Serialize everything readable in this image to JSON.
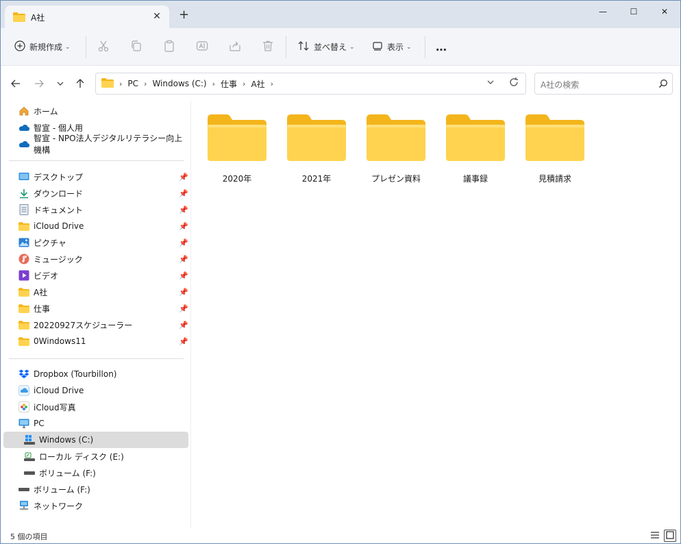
{
  "window": {
    "tab_title": "A社",
    "minimize_glyph": "—",
    "maximize_glyph": "☐",
    "close_glyph": "✕"
  },
  "toolbar": {
    "new_label": "新規作成",
    "sort_label": "並べ替え",
    "view_label": "表示",
    "more_label": "…"
  },
  "address": {
    "crumbs": [
      "PC",
      "Windows (C:)",
      "仕事",
      "A社"
    ],
    "search_placeholder": "A社の検索"
  },
  "sidebar": {
    "quick": [
      {
        "label": "ホーム",
        "icon": "home-icon"
      },
      {
        "label": "智宣 - 個人用",
        "icon": "onedrive-icon"
      },
      {
        "label": "智宣 - NPO法人デジタルリテラシー向上機構",
        "icon": "onedrive-icon"
      }
    ],
    "pinned": [
      {
        "label": "デスクトップ",
        "icon": "desktop-icon"
      },
      {
        "label": "ダウンロード",
        "icon": "download-icon"
      },
      {
        "label": "ドキュメント",
        "icon": "document-icon"
      },
      {
        "label": "iCloud Drive",
        "icon": "folder-icon"
      },
      {
        "label": "ピクチャ",
        "icon": "pictures-icon"
      },
      {
        "label": "ミュージック",
        "icon": "music-icon"
      },
      {
        "label": "ビデオ",
        "icon": "video-icon"
      },
      {
        "label": "A社",
        "icon": "folder-icon"
      },
      {
        "label": "仕事",
        "icon": "folder-icon"
      },
      {
        "label": "20220927スケジューラー",
        "icon": "folder-icon"
      },
      {
        "label": "0Windows11",
        "icon": "folder-icon"
      }
    ],
    "devices": [
      {
        "label": "Dropbox (Tourbillon)",
        "icon": "dropbox-icon"
      },
      {
        "label": "iCloud Drive",
        "icon": "icloud-icon"
      },
      {
        "label": "iCloud写真",
        "icon": "icloud-photos-icon"
      },
      {
        "label": "PC",
        "icon": "pc-icon"
      },
      {
        "label": "Windows (C:)",
        "icon": "drive-c-icon",
        "selected": true
      },
      {
        "label": "ローカル ディスク (E:)",
        "icon": "drive-e-icon"
      },
      {
        "label": "ボリューム (F:)",
        "icon": "drive-f-icon"
      },
      {
        "label": "ボリューム (F:)",
        "icon": "removable-drive-icon"
      },
      {
        "label": "ネットワーク",
        "icon": "network-icon"
      }
    ]
  },
  "content": {
    "folders": [
      "2020年",
      "2021年",
      "プレゼン資料",
      "議事録",
      "見積請求"
    ]
  },
  "status": {
    "count_text": "5 個の項目"
  },
  "colors": {
    "folder_front": "#ffd34f",
    "folder_back": "#f4b51c",
    "accent": "#0067c0",
    "selected_bg": "#dcdcdc"
  }
}
